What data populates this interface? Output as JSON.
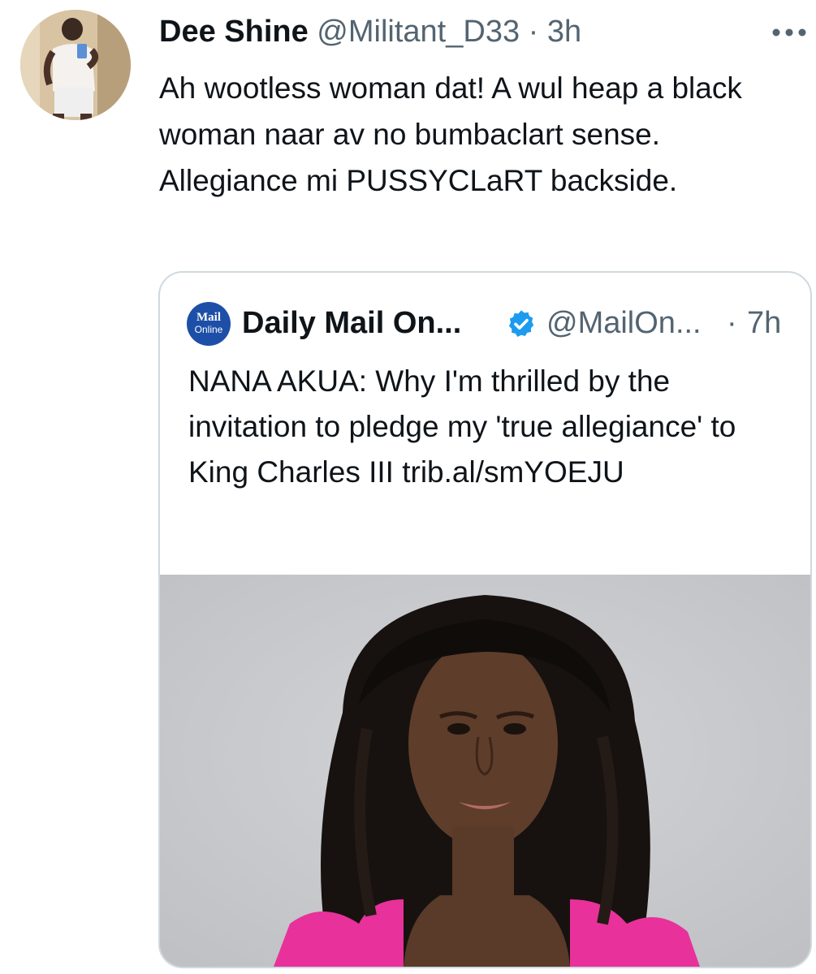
{
  "tweet": {
    "author_name": "Dee Shine",
    "handle": "@Militant_D33",
    "separator": "·",
    "time": "3h",
    "more_icon": "more-horizontal-icon",
    "text": "Ah wootless woman dat! A wul heap a black woman naar av no bumbaclart sense. Allegiance mi PUSSYCLaRT backside."
  },
  "quoted_tweet": {
    "logo_line1": "Mail",
    "logo_line2": "Online",
    "author_name": "Daily Mail On...",
    "verified_icon": "verified-badge-icon",
    "handle": "@MailOn...",
    "separator": "·",
    "time": "7h",
    "text": "NANA AKUA: Why I'm thrilled by the invitation to pledge my 'true allegiance' to King Charles III trib.al/smYOEJU"
  },
  "colors": {
    "text_primary": "#0f1419",
    "text_secondary": "#536471",
    "border": "#cfd9de",
    "verified_blue": "#1d9bf0",
    "photo_background": "#c9cbce",
    "blouse_pink": "#e8319a"
  }
}
